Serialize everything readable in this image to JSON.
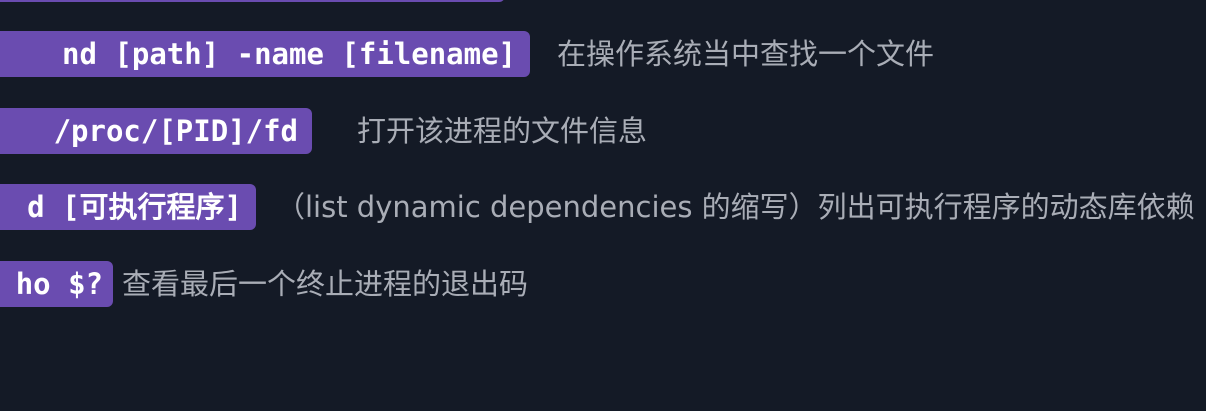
{
  "rows": [
    {
      "command": "nd [path] -name [filename]",
      "description": "在操作系统当中查找一个文件"
    },
    {
      "command": " /proc/[PID]/fd",
      "description": "打开该进程的文件信息"
    },
    {
      "command": "d [可执行程序]",
      "description": "（list dynamic dependencies 的缩写）列出可执行程序的动态库依赖"
    },
    {
      "command": "ho $?",
      "description": "查看最后一个终止进程的退出码"
    }
  ],
  "colors": {
    "background": "#141a26",
    "command_pill": "#6a4cb0",
    "command_text": "#ffffff",
    "description_text": "#a9adb6"
  }
}
